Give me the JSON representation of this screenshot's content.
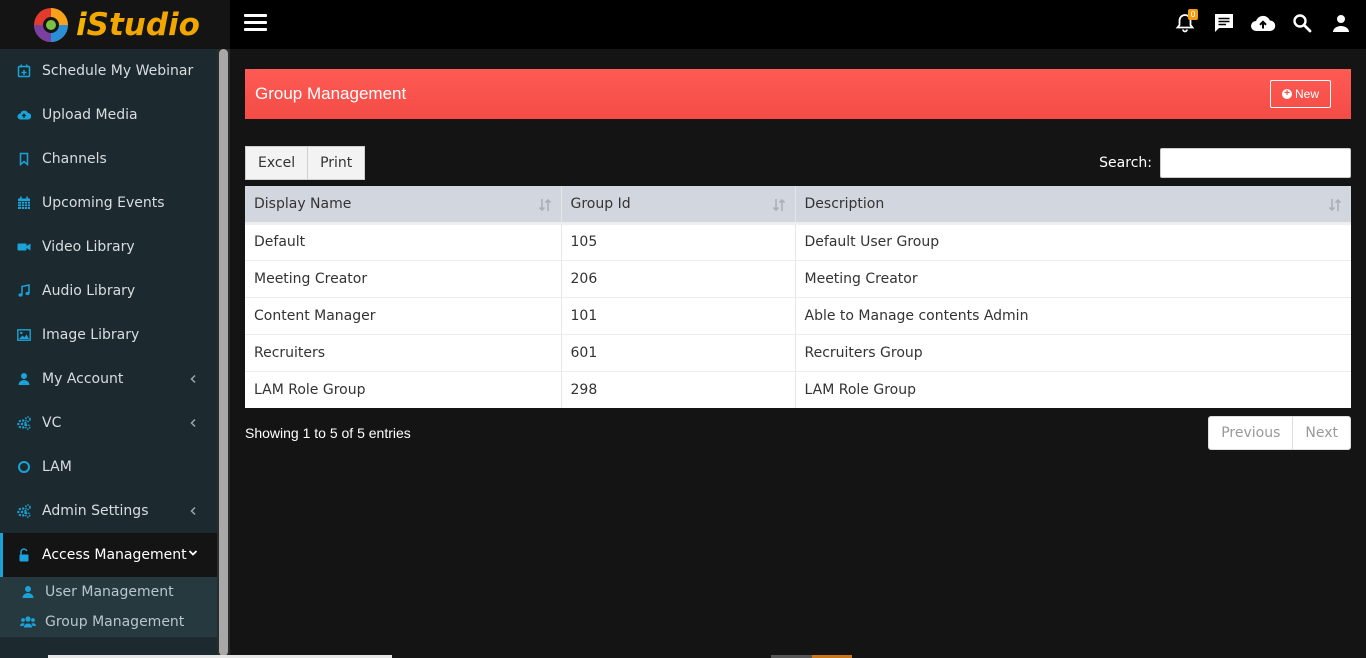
{
  "brand": {
    "name": "iStudio",
    "i": "i",
    "rest": "Studio"
  },
  "sidebar": {
    "items": [
      {
        "label": "Schedule My Webinar",
        "icon": "calendar-plus-icon"
      },
      {
        "label": "Upload Media",
        "icon": "cloud-upload-icon"
      },
      {
        "label": "Channels",
        "icon": "bookmark-icon"
      },
      {
        "label": "Upcoming Events",
        "icon": "calendar-icon"
      },
      {
        "label": "Video Library",
        "icon": "video-camera-icon"
      },
      {
        "label": "Audio Library",
        "icon": "music-note-icon"
      },
      {
        "label": "Image Library",
        "icon": "image-icon"
      },
      {
        "label": "My Account",
        "icon": "user-icon"
      },
      {
        "label": "VC",
        "icon": "cogs-icon"
      },
      {
        "label": "LAM",
        "icon": "circle-icon"
      },
      {
        "label": "Admin Settings",
        "icon": "cogs-icon"
      },
      {
        "label": "Access Management",
        "icon": "unlock-icon"
      }
    ],
    "subitems": [
      {
        "label": "User Management",
        "icon": "user-icon"
      },
      {
        "label": "Group Management",
        "icon": "users-icon"
      }
    ]
  },
  "topbar": {
    "notification_count": "0"
  },
  "header": {
    "title": "Group Management",
    "new_label": "New"
  },
  "tools": {
    "excel_label": "Excel",
    "print_label": "Print",
    "search_label": "Search:",
    "search_value": ""
  },
  "table": {
    "columns": [
      "Display Name",
      "Group Id",
      "Description"
    ],
    "rows": [
      [
        "Default",
        "105",
        "Default User Group"
      ],
      [
        "Meeting Creator",
        "206",
        "Meeting Creator"
      ],
      [
        "Content Manager",
        "101",
        "Able to Manage contents Admin"
      ],
      [
        "Recruiters",
        "601",
        "Recruiters Group"
      ],
      [
        "LAM Role Group",
        "298",
        "LAM Role Group"
      ]
    ]
  },
  "footer": {
    "info": "Showing 1 to 5 of 5 entries",
    "previous_label": "Previous",
    "next_label": "Next"
  },
  "colors": {
    "accent": "#1aa3d9",
    "header": "#f44c45",
    "brand": "#f2a600"
  }
}
